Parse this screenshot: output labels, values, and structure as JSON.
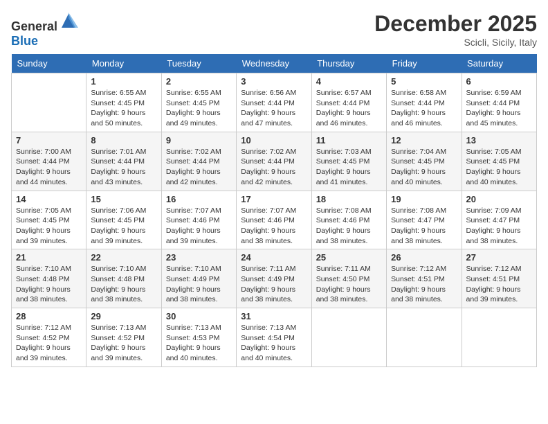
{
  "logo": {
    "general": "General",
    "blue": "Blue"
  },
  "header": {
    "month_title": "December 2025",
    "location": "Scicli, Sicily, Italy"
  },
  "weekdays": [
    "Sunday",
    "Monday",
    "Tuesday",
    "Wednesday",
    "Thursday",
    "Friday",
    "Saturday"
  ],
  "weeks": [
    [
      {
        "day": "",
        "sunrise": "",
        "sunset": "",
        "daylight": ""
      },
      {
        "day": "1",
        "sunrise": "Sunrise: 6:55 AM",
        "sunset": "Sunset: 4:45 PM",
        "daylight": "Daylight: 9 hours and 50 minutes."
      },
      {
        "day": "2",
        "sunrise": "Sunrise: 6:55 AM",
        "sunset": "Sunset: 4:45 PM",
        "daylight": "Daylight: 9 hours and 49 minutes."
      },
      {
        "day": "3",
        "sunrise": "Sunrise: 6:56 AM",
        "sunset": "Sunset: 4:44 PM",
        "daylight": "Daylight: 9 hours and 47 minutes."
      },
      {
        "day": "4",
        "sunrise": "Sunrise: 6:57 AM",
        "sunset": "Sunset: 4:44 PM",
        "daylight": "Daylight: 9 hours and 46 minutes."
      },
      {
        "day": "5",
        "sunrise": "Sunrise: 6:58 AM",
        "sunset": "Sunset: 4:44 PM",
        "daylight": "Daylight: 9 hours and 46 minutes."
      },
      {
        "day": "6",
        "sunrise": "Sunrise: 6:59 AM",
        "sunset": "Sunset: 4:44 PM",
        "daylight": "Daylight: 9 hours and 45 minutes."
      }
    ],
    [
      {
        "day": "7",
        "sunrise": "Sunrise: 7:00 AM",
        "sunset": "Sunset: 4:44 PM",
        "daylight": "Daylight: 9 hours and 44 minutes."
      },
      {
        "day": "8",
        "sunrise": "Sunrise: 7:01 AM",
        "sunset": "Sunset: 4:44 PM",
        "daylight": "Daylight: 9 hours and 43 minutes."
      },
      {
        "day": "9",
        "sunrise": "Sunrise: 7:02 AM",
        "sunset": "Sunset: 4:44 PM",
        "daylight": "Daylight: 9 hours and 42 minutes."
      },
      {
        "day": "10",
        "sunrise": "Sunrise: 7:02 AM",
        "sunset": "Sunset: 4:44 PM",
        "daylight": "Daylight: 9 hours and 42 minutes."
      },
      {
        "day": "11",
        "sunrise": "Sunrise: 7:03 AM",
        "sunset": "Sunset: 4:45 PM",
        "daylight": "Daylight: 9 hours and 41 minutes."
      },
      {
        "day": "12",
        "sunrise": "Sunrise: 7:04 AM",
        "sunset": "Sunset: 4:45 PM",
        "daylight": "Daylight: 9 hours and 40 minutes."
      },
      {
        "day": "13",
        "sunrise": "Sunrise: 7:05 AM",
        "sunset": "Sunset: 4:45 PM",
        "daylight": "Daylight: 9 hours and 40 minutes."
      }
    ],
    [
      {
        "day": "14",
        "sunrise": "Sunrise: 7:05 AM",
        "sunset": "Sunset: 4:45 PM",
        "daylight": "Daylight: 9 hours and 39 minutes."
      },
      {
        "day": "15",
        "sunrise": "Sunrise: 7:06 AM",
        "sunset": "Sunset: 4:45 PM",
        "daylight": "Daylight: 9 hours and 39 minutes."
      },
      {
        "day": "16",
        "sunrise": "Sunrise: 7:07 AM",
        "sunset": "Sunset: 4:46 PM",
        "daylight": "Daylight: 9 hours and 39 minutes."
      },
      {
        "day": "17",
        "sunrise": "Sunrise: 7:07 AM",
        "sunset": "Sunset: 4:46 PM",
        "daylight": "Daylight: 9 hours and 38 minutes."
      },
      {
        "day": "18",
        "sunrise": "Sunrise: 7:08 AM",
        "sunset": "Sunset: 4:46 PM",
        "daylight": "Daylight: 9 hours and 38 minutes."
      },
      {
        "day": "19",
        "sunrise": "Sunrise: 7:08 AM",
        "sunset": "Sunset: 4:47 PM",
        "daylight": "Daylight: 9 hours and 38 minutes."
      },
      {
        "day": "20",
        "sunrise": "Sunrise: 7:09 AM",
        "sunset": "Sunset: 4:47 PM",
        "daylight": "Daylight: 9 hours and 38 minutes."
      }
    ],
    [
      {
        "day": "21",
        "sunrise": "Sunrise: 7:10 AM",
        "sunset": "Sunset: 4:48 PM",
        "daylight": "Daylight: 9 hours and 38 minutes."
      },
      {
        "day": "22",
        "sunrise": "Sunrise: 7:10 AM",
        "sunset": "Sunset: 4:48 PM",
        "daylight": "Daylight: 9 hours and 38 minutes."
      },
      {
        "day": "23",
        "sunrise": "Sunrise: 7:10 AM",
        "sunset": "Sunset: 4:49 PM",
        "daylight": "Daylight: 9 hours and 38 minutes."
      },
      {
        "day": "24",
        "sunrise": "Sunrise: 7:11 AM",
        "sunset": "Sunset: 4:49 PM",
        "daylight": "Daylight: 9 hours and 38 minutes."
      },
      {
        "day": "25",
        "sunrise": "Sunrise: 7:11 AM",
        "sunset": "Sunset: 4:50 PM",
        "daylight": "Daylight: 9 hours and 38 minutes."
      },
      {
        "day": "26",
        "sunrise": "Sunrise: 7:12 AM",
        "sunset": "Sunset: 4:51 PM",
        "daylight": "Daylight: 9 hours and 38 minutes."
      },
      {
        "day": "27",
        "sunrise": "Sunrise: 7:12 AM",
        "sunset": "Sunset: 4:51 PM",
        "daylight": "Daylight: 9 hours and 39 minutes."
      }
    ],
    [
      {
        "day": "28",
        "sunrise": "Sunrise: 7:12 AM",
        "sunset": "Sunset: 4:52 PM",
        "daylight": "Daylight: 9 hours and 39 minutes."
      },
      {
        "day": "29",
        "sunrise": "Sunrise: 7:13 AM",
        "sunset": "Sunset: 4:52 PM",
        "daylight": "Daylight: 9 hours and 39 minutes."
      },
      {
        "day": "30",
        "sunrise": "Sunrise: 7:13 AM",
        "sunset": "Sunset: 4:53 PM",
        "daylight": "Daylight: 9 hours and 40 minutes."
      },
      {
        "day": "31",
        "sunrise": "Sunrise: 7:13 AM",
        "sunset": "Sunset: 4:54 PM",
        "daylight": "Daylight: 9 hours and 40 minutes."
      },
      {
        "day": "",
        "sunrise": "",
        "sunset": "",
        "daylight": ""
      },
      {
        "day": "",
        "sunrise": "",
        "sunset": "",
        "daylight": ""
      },
      {
        "day": "",
        "sunrise": "",
        "sunset": "",
        "daylight": ""
      }
    ]
  ]
}
